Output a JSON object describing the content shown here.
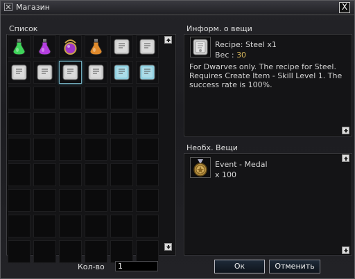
{
  "window": {
    "title": "Магазин",
    "close_glyph": "X"
  },
  "list": {
    "label": "Список",
    "items": [
      {
        "name": "green-potion-icon",
        "kind": "potion",
        "color": "#3fd35a"
      },
      {
        "name": "purple-potion-icon",
        "kind": "potion",
        "color": "#b43ee0"
      },
      {
        "name": "purple-jewel-icon",
        "kind": "jewel",
        "color": "#a035c8"
      },
      {
        "name": "orange-potion-icon",
        "kind": "potion",
        "color": "#e08a2c"
      },
      {
        "name": "recipe-scroll-icon",
        "kind": "scroll",
        "color": "#cfcfcf"
      },
      {
        "name": "recipe-scroll-icon",
        "kind": "scroll",
        "color": "#cfcfcf"
      },
      {
        "name": "recipe-scroll-icon",
        "kind": "scroll",
        "color": "#cfcfcf"
      },
      {
        "name": "recipe-scroll-icon",
        "kind": "scroll",
        "color": "#cfcfcf"
      },
      {
        "name": "recipe-scroll-icon",
        "kind": "scroll",
        "color": "#cfcfcf"
      },
      {
        "name": "recipe-scroll-icon",
        "kind": "scroll",
        "color": "#cfcfcf"
      },
      {
        "name": "blue-recipe-scroll-icon",
        "kind": "scroll",
        "color": "#8fd0e0"
      },
      {
        "name": "blue-recipe-scroll-icon",
        "kind": "scroll",
        "color": "#8fd0e0"
      }
    ],
    "selected_index": 8
  },
  "item_info": {
    "label": "Информ. о вещи",
    "item_name": "Recipe: Steel x1",
    "weight_label": "Вес : ",
    "weight_value": "30",
    "description": "For Dwarves only. The recipe for Steel. Requires Create Item - Skill Level 1. The success rate is 100%."
  },
  "required_items": {
    "label": "Необх. Вещи",
    "item_name": "Event - Medal",
    "item_count": "x 100"
  },
  "quantity": {
    "label": "Кол-во",
    "value": "1"
  },
  "buttons": {
    "ok": "Ок",
    "cancel": "Отменить"
  },
  "colors": {
    "accent_weight": "#d9b85c",
    "selection": "#6fa8b8"
  }
}
